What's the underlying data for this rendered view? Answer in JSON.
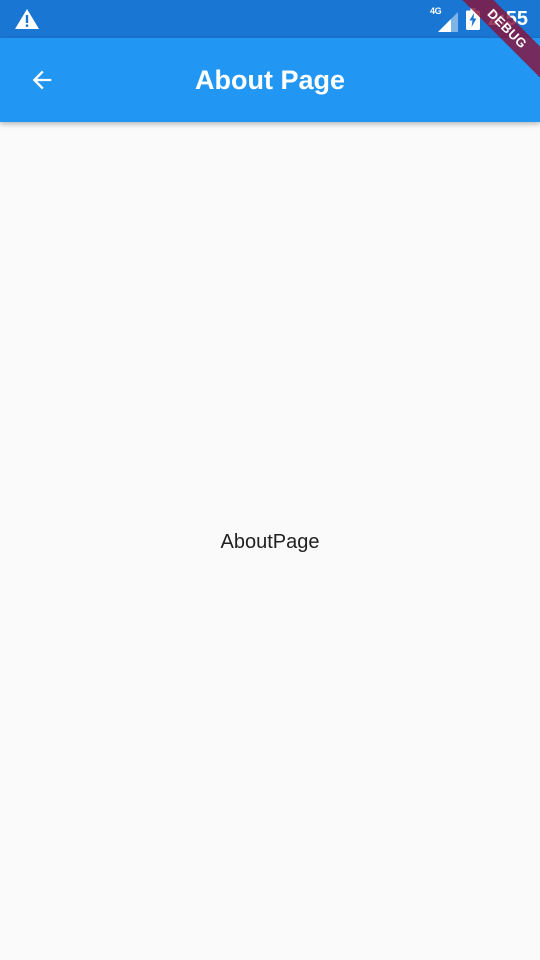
{
  "status_bar": {
    "network_type": "4G",
    "time": "2:55",
    "icons": [
      "warning-icon",
      "signal-icon",
      "battery-charging-icon"
    ]
  },
  "app_bar": {
    "back_icon": "arrow-back-icon",
    "title": "About Page"
  },
  "body": {
    "text": "AboutPage"
  },
  "debug_banner": {
    "label": "DEBUG"
  },
  "colors": {
    "status_bar": "#1976d2",
    "app_bar": "#2196f3",
    "background": "#fafafa",
    "debug_banner": "#88143c"
  }
}
